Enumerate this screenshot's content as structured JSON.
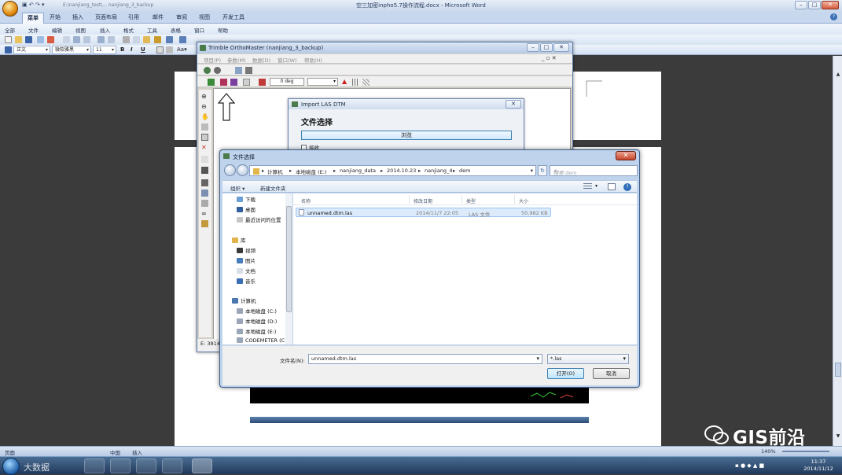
{
  "word": {
    "title": "空三加密inpho5.7操作流程.docx - Microsoft Word",
    "recent_doc": "E:\\nanjiang_test\\... nanjiang_3_backup",
    "tabs": [
      "菜单",
      "开始",
      "插入",
      "页面布局",
      "引用",
      "邮件",
      "审阅",
      "视图",
      "开发工具"
    ],
    "active_tab": "菜单",
    "menus": [
      "全部",
      "文件",
      "编辑",
      "视图",
      "插入",
      "格式",
      "工具",
      "表格",
      "窗口",
      "帮助"
    ],
    "style_combo": "正文",
    "font_combo": "微软雅黑",
    "size_combo": "11",
    "status": {
      "page": "页面",
      "chinese": "中国",
      "insert": "插入",
      "zoom": "140%"
    },
    "clock_time": "11:37",
    "clock_date": "2014/11/12",
    "watermark": "GIS前沿",
    "watermark_bottom": "大数据"
  },
  "ortho": {
    "title": "Trimble OrthoMaster (nanjiang_3_backup)",
    "menus": [
      "项目(P)",
      "参数(M)",
      "数据(D)",
      "窗口(W)",
      "帮助(H)"
    ],
    "angle": "0 deg",
    "coord_prefix": "E: 3814"
  },
  "las_dialog": {
    "title": "Import LAS DTM",
    "heading": "文件选择",
    "browse_label": "浏览",
    "checkbox_label": "接收"
  },
  "file_dialog": {
    "title": "文件选择",
    "breadcrumb": [
      "计算机",
      "本地磁盘 (E:)",
      "nanjiang_data",
      "2014.10.23",
      "nanjiang_4",
      "dem"
    ],
    "search_placeholder": "搜索 dem",
    "organize": "组织 ▾",
    "new_folder": "新建文件夹",
    "nav_items": [
      {
        "label": "下载",
        "indent": 1
      },
      {
        "label": "桌面",
        "indent": 1
      },
      {
        "label": "最近访问的位置",
        "indent": 1
      },
      {
        "label": "库",
        "indent": 0
      },
      {
        "label": "视频",
        "indent": 1
      },
      {
        "label": "图片",
        "indent": 1
      },
      {
        "label": "文档",
        "indent": 1
      },
      {
        "label": "音乐",
        "indent": 1
      },
      {
        "label": "计算机",
        "indent": 0
      },
      {
        "label": "本地磁盘 (C:)",
        "indent": 1
      },
      {
        "label": "本地磁盘 (D:)",
        "indent": 1
      },
      {
        "label": "本地磁盘 (E:)",
        "indent": 1
      },
      {
        "label": "CODEMETER (C",
        "indent": 1
      }
    ],
    "columns": [
      "名称",
      "修改日期",
      "类型",
      "大小"
    ],
    "files": [
      {
        "name": "unnamed.dtm.las",
        "modified": "2014/11/7 22:05",
        "type": "LAS 文件",
        "size": "50,982 KB"
      }
    ],
    "filename_label": "文件名(N):",
    "filename_value": "unnamed.dtm.las",
    "filetype_value": "*.las",
    "open_label": "打开(O)",
    "cancel_label": "取消"
  },
  "colors": {
    "accent": "#3c7fb1",
    "selection": "#dcebfc",
    "dialog_frame": "#bfd3ec"
  }
}
